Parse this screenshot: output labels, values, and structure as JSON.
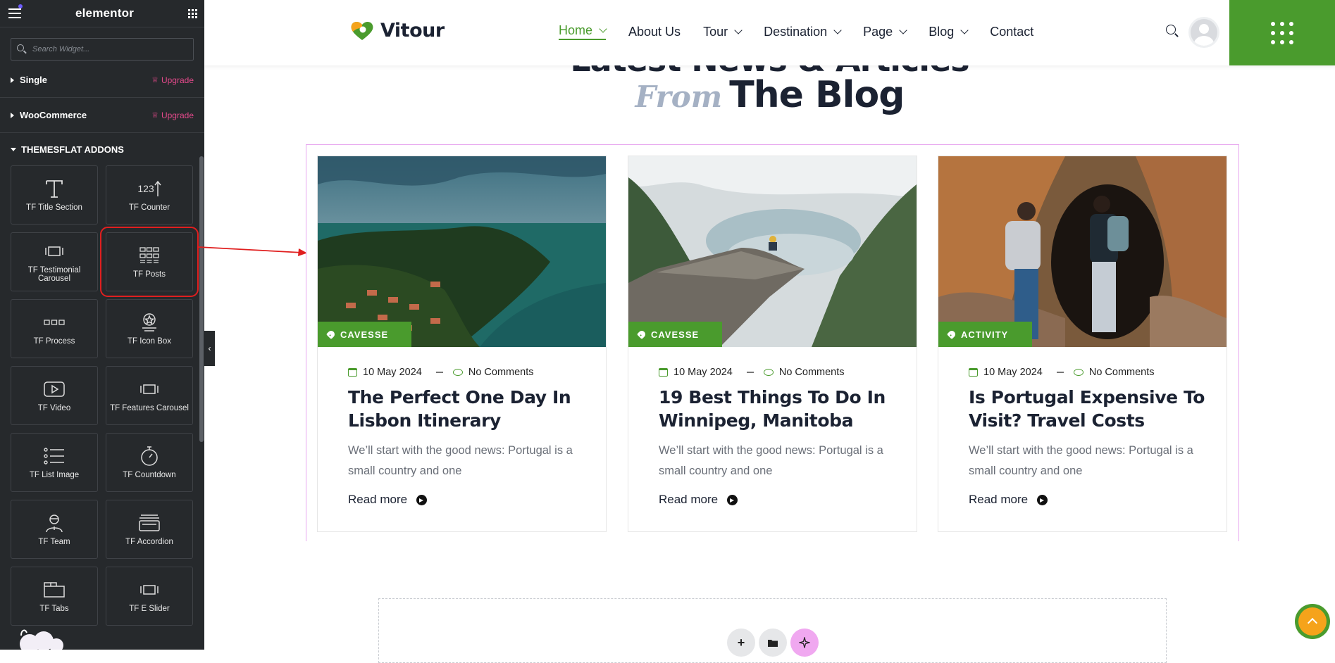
{
  "sidebar": {
    "logo": "elementor",
    "search_placeholder": "Search Widget...",
    "categories": [
      {
        "label": "Single",
        "badge": "Upgrade"
      },
      {
        "label": "WooCommerce",
        "badge": "Upgrade"
      }
    ],
    "open_category": "THEMESFLAT ADDONS",
    "widgets": [
      {
        "label": "TF Title Section",
        "icon": "title-icon"
      },
      {
        "label": "TF Counter",
        "icon": "counter-icon"
      },
      {
        "label": "TF Testimonial Carousel",
        "icon": "carousel-icon"
      },
      {
        "label": "TF Posts",
        "icon": "posts-grid-icon"
      },
      {
        "label": "TF Process",
        "icon": "process-icon"
      },
      {
        "label": "TF Icon Box",
        "icon": "icon-box-icon"
      },
      {
        "label": "TF Video",
        "icon": "video-icon"
      },
      {
        "label": "TF Features Carousel",
        "icon": "carousel-icon"
      },
      {
        "label": "TF List Image",
        "icon": "list-icon"
      },
      {
        "label": "TF Countdown",
        "icon": "stopwatch-icon"
      },
      {
        "label": "TF Team",
        "icon": "team-icon"
      },
      {
        "label": "TF Accordion",
        "icon": "accordion-icon"
      },
      {
        "label": "TF Tabs",
        "icon": "tabs-icon"
      },
      {
        "label": "TF E Slider",
        "icon": "slider-icon"
      }
    ],
    "counter_glyph": "123",
    "collapse_glyph": "‹"
  },
  "site": {
    "brand": "Vitour",
    "nav": [
      {
        "label": "Home",
        "dropdown": true,
        "active": true
      },
      {
        "label": "About Us",
        "dropdown": false
      },
      {
        "label": "Tour",
        "dropdown": true
      },
      {
        "label": "Destination",
        "dropdown": true
      },
      {
        "label": "Page",
        "dropdown": true
      },
      {
        "label": "Blog",
        "dropdown": true
      },
      {
        "label": "Contact",
        "dropdown": false
      }
    ],
    "section_title_line1": "Latest News & Articles",
    "section_title_from": "From",
    "section_title_blog": "The Blog",
    "posts": [
      {
        "tag": "CAVESSE",
        "date": "10 May 2024",
        "comments": "No Comments",
        "title": "The Perfect One Day In Lisbon Itinerary",
        "excerpt": "We’ll start with the good news: Portugal is a small country and one",
        "read_more": "Read more"
      },
      {
        "tag": "CAVESSE",
        "date": "10 May 2024",
        "comments": "No Comments",
        "title": "19 Best Things To Do In Winnipeg, Manitoba",
        "excerpt": "We’ll start with the good news: Portugal is a small country and one",
        "read_more": "Read more"
      },
      {
        "tag": "ACTIVITY",
        "date": "10 May 2024",
        "comments": "No Comments",
        "title": "Is Portugal Expensive To Visit? Travel Costs",
        "excerpt": "We’ll start with the good news: Portugal is a small country and one",
        "read_more": "Read more"
      }
    ],
    "dropzone_buttons": [
      "+",
      "folder-icon",
      "ai-sparkle-icon"
    ],
    "plus_glyph": "+"
  },
  "colors": {
    "accent": "#4a9b2d",
    "highlight": "#e01f1f",
    "upgrade": "#e2498a"
  }
}
